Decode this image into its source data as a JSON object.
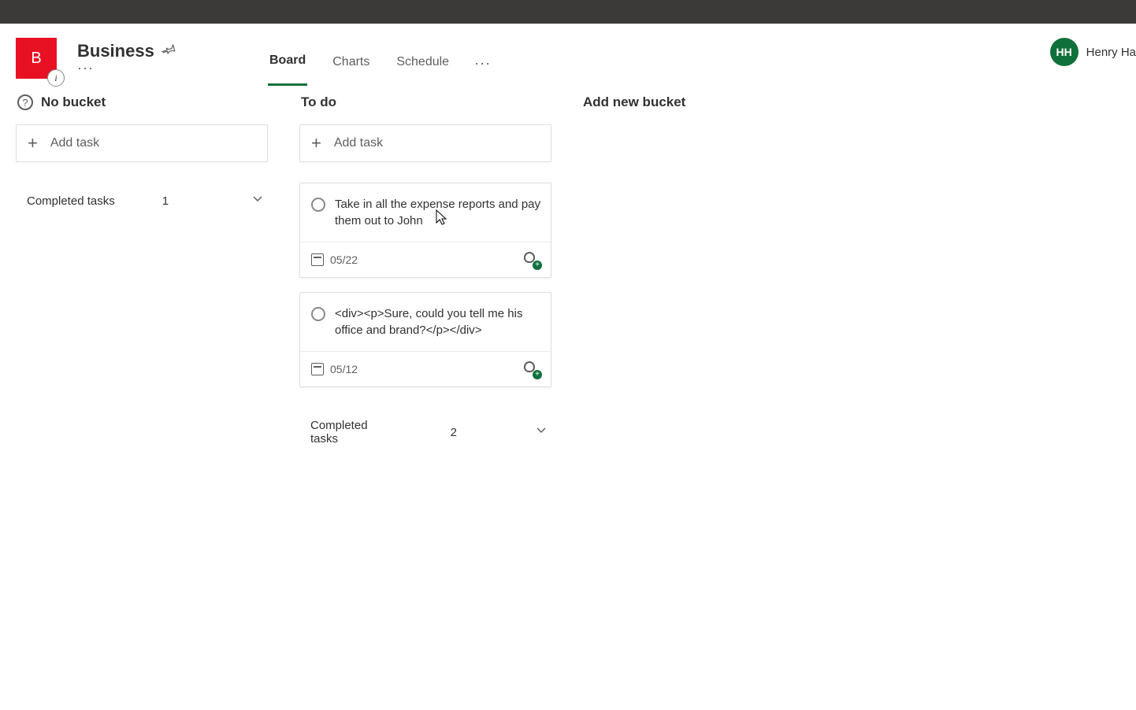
{
  "plan": {
    "tile_letter": "B",
    "title": "Business",
    "ellipsis": "···",
    "info_badge": "i"
  },
  "tabs": {
    "board": "Board",
    "charts": "Charts",
    "schedule": "Schedule",
    "more": "···"
  },
  "user": {
    "initials": "HH",
    "name": "Henry Ha"
  },
  "buckets": {
    "no_bucket": {
      "title": "No bucket",
      "add_task": "Add task",
      "completed_label": "Completed tasks",
      "completed_count": "1"
    },
    "todo": {
      "title": "To do",
      "add_task": "Add task",
      "tasks": [
        {
          "text": "Take in all the expense reports and pay them out to John",
          "date": "05/22",
          "show_more": true
        },
        {
          "text": "<div><p>Sure, could you tell me his office and brand?</p></div>",
          "date": "05/12",
          "show_more": false
        }
      ],
      "completed_label": "Completed tasks",
      "completed_count": "2"
    },
    "add_new": "Add new bucket"
  },
  "ellipsis": "···",
  "help_char": "?",
  "plus_char": "+"
}
